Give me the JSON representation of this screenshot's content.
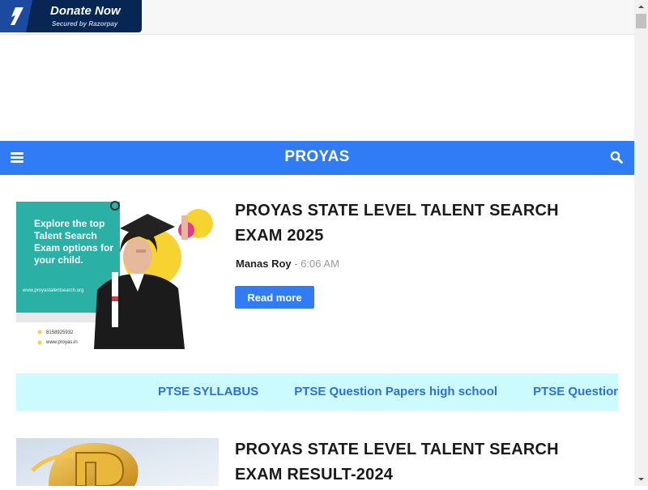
{
  "donate": {
    "label": "Donate Now",
    "sublabel": "Secured by Razorpay"
  },
  "navbar": {
    "brand": "PROYAS",
    "menu_icon": "hamburger-menu-icon",
    "search_icon": "search-icon"
  },
  "posts": [
    {
      "title": "PROYAS STATE LEVEL TALENT SEARCH EXAM 2025",
      "author": "Manas Roy",
      "separator": " - ",
      "time": "6:06 AM",
      "read_more": "Read more",
      "thumbnail": {
        "headline": "Explore the top Talent Search Exam options for your child.",
        "website": "www.proyastalentsearch.org",
        "phone": "8158925932",
        "site2": "www.proyas.in"
      }
    },
    {
      "title": "PROYAS STATE LEVEL TALENT SEARCH EXAM RESULT-2024"
    }
  ],
  "ticker": {
    "items": [
      "PTSE SYLLABUS",
      "PTSE Question Papers high school",
      "PTSE Question Papers"
    ]
  },
  "colors": {
    "accent": "#2f7cf6",
    "donate_bg": "#072654",
    "ticker_bg": "#ccfbff",
    "ticker_text": "#2f6edb"
  }
}
